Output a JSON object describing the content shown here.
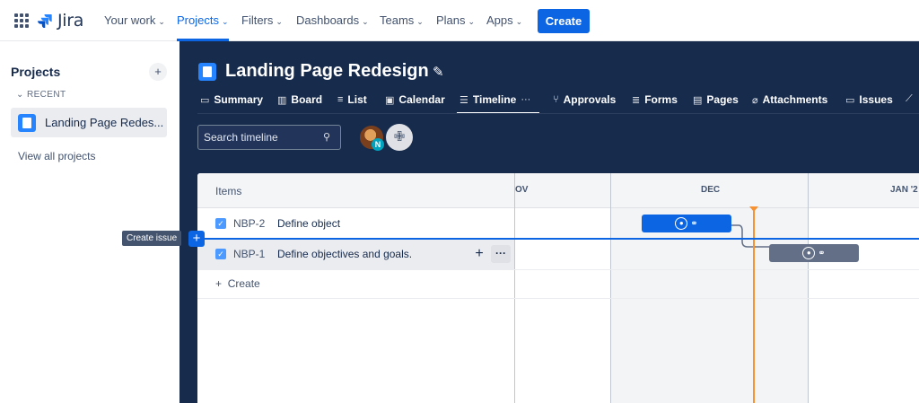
{
  "nav": {
    "logo": "Jira",
    "items": [
      "Your work",
      "Projects",
      "Filters",
      "Dashboards",
      "Teams",
      "Plans",
      "Apps"
    ],
    "create": "Create"
  },
  "sidebar": {
    "title": "Projects",
    "add": "+",
    "recent": "RECENT",
    "project": "Landing Page Redes...",
    "view_all": "View all projects"
  },
  "project": {
    "title": "Landing Page Redesign",
    "tabs": [
      "Summary",
      "Board",
      "List",
      "Calendar",
      "Timeline",
      "Approvals",
      "Forms",
      "Pages",
      "Attachments",
      "Issues"
    ],
    "active_tab": "Timeline",
    "search_placeholder": "Search timeline",
    "avatar_badge": "N"
  },
  "timeline": {
    "items_label": "Items",
    "months": [
      "OV",
      "DEC",
      "JAN '2"
    ],
    "rows": [
      {
        "key": "NBP-2",
        "summary": "Define object"
      },
      {
        "key": "NBP-1",
        "summary": "Define objectives and goals."
      }
    ],
    "create_label": "Create",
    "create_issue_tooltip": "Create issue"
  },
  "colors": {
    "accent": "#0c66e4",
    "dark_bg": "#172b4d",
    "today": "#f79233",
    "bar_gray": "#626f86"
  }
}
